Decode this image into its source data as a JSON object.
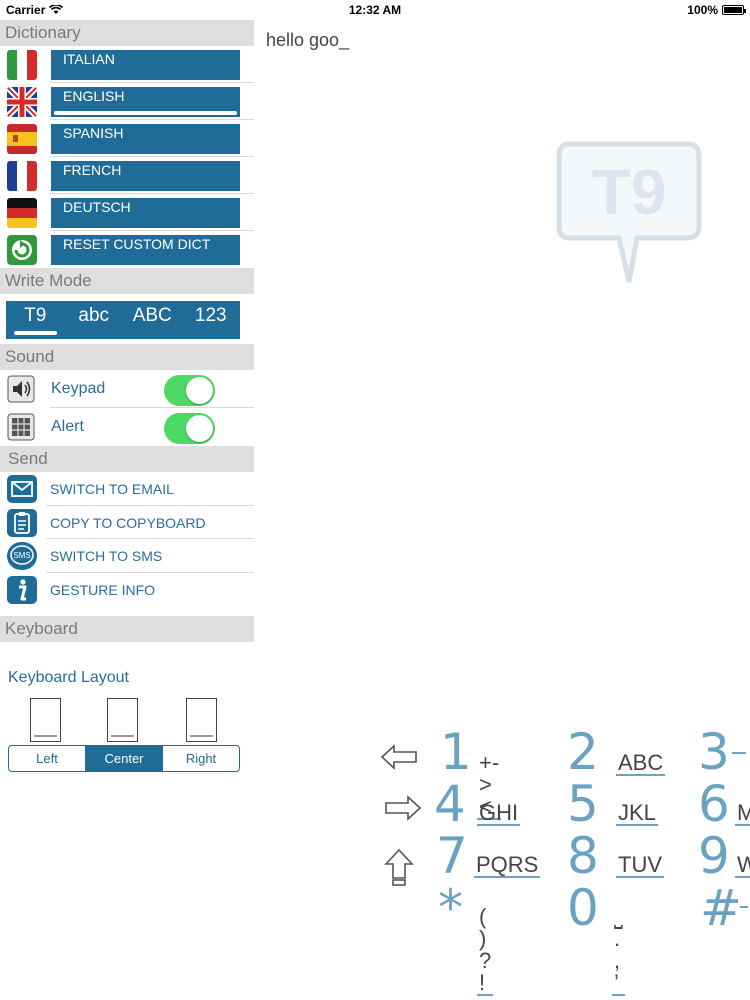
{
  "status": {
    "carrier": "Carrier",
    "time": "12:32 AM",
    "battery": "100%"
  },
  "sections": {
    "dictionary": "Dictionary",
    "write_mode": "Write Mode",
    "sound": "Sound",
    "send": "Send",
    "keyboard": "Keyboard"
  },
  "dictionary": [
    {
      "label": "ITALIAN",
      "icon": "italy-flag-icon"
    },
    {
      "label": "ENGLISH",
      "icon": "uk-flag-icon",
      "selected": true
    },
    {
      "label": "SPANISH",
      "icon": "spain-flag-icon"
    },
    {
      "label": "FRENCH",
      "icon": "france-flag-icon"
    },
    {
      "label": "DEUTSCH",
      "icon": "germany-flag-icon"
    },
    {
      "label": "RESET CUSTOM DICT",
      "icon": "reset-icon"
    }
  ],
  "write_modes": [
    "T9",
    "abc",
    "ABC",
    "123"
  ],
  "write_mode_selected": "T9",
  "sound": [
    {
      "label": "Keypad",
      "on": true,
      "icon": "speaker-icon"
    },
    {
      "label": "Alert",
      "on": true,
      "icon": "alert-icon"
    }
  ],
  "send": [
    {
      "label": "SWITCH TO EMAIL",
      "icon": "email-icon"
    },
    {
      "label": "COPY TO COPYBOARD",
      "icon": "clipboard-icon"
    },
    {
      "label": "SWITCH TO SMS",
      "icon": "sms-icon"
    },
    {
      "label": "GESTURE INFO",
      "icon": "info-icon"
    }
  ],
  "keyboard_layout": {
    "title": "Keyboard Layout",
    "options": [
      "Left",
      "Center",
      "Right"
    ],
    "selected": "Center"
  },
  "text": "hello goo_",
  "logo_text": "T9",
  "sms_icon_text": "SMS",
  "keypad": {
    "rows": [
      [
        {
          "d": "1",
          "l": "+-><"
        },
        {
          "d": "2",
          "l": "ABC"
        },
        {
          "d": "3",
          "l": ""
        }
      ],
      [
        {
          "d": "4",
          "l": "GHI"
        },
        {
          "d": "5",
          "l": "JKL"
        },
        {
          "d": "6",
          "l": "M"
        }
      ],
      [
        {
          "d": "7",
          "l": "PQRS"
        },
        {
          "d": "8",
          "l": "TUV"
        },
        {
          "d": "9",
          "l": "W"
        }
      ],
      [
        {
          "d": "*",
          "l": "( ) ? !"
        },
        {
          "d": "0",
          "l": "⎵ . , ’"
        },
        {
          "d": "#",
          "l": ""
        }
      ]
    ]
  },
  "colors": {
    "accent": "#1e6c97",
    "key_digit": "#6aa3c2",
    "toggle_on": "#4cd964"
  }
}
